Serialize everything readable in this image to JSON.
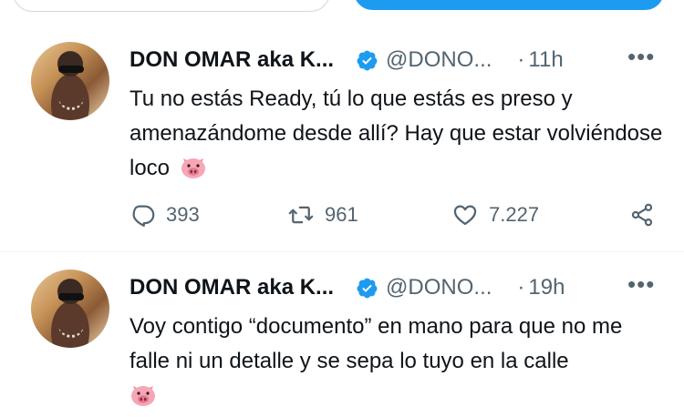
{
  "tweets": [
    {
      "name": "DON OMAR aka K...",
      "handle": "@DONO...",
      "dot": "·",
      "time": "11h",
      "more": "•••",
      "text": "Tu no estás Ready, tú lo que estás es preso y amenazándome desde allí? Hay que estar volviéndose loco",
      "emoji": "pig-face",
      "replies": "393",
      "retweets": "961",
      "likes": "7.227"
    },
    {
      "name": "DON OMAR aka K...",
      "handle": "@DONO...",
      "dot": "·",
      "time": "19h",
      "more": "•••",
      "text": "Voy contigo “documento” en mano para que no me falle ni un detalle y se sepa lo tuyo en la calle",
      "emoji": "pig-face"
    }
  ],
  "colors": {
    "primary": "#1d9bf0",
    "text": "#0f1419",
    "muted": "#536471",
    "pig": "#f7a6b5",
    "divider": "#eff3f4"
  }
}
